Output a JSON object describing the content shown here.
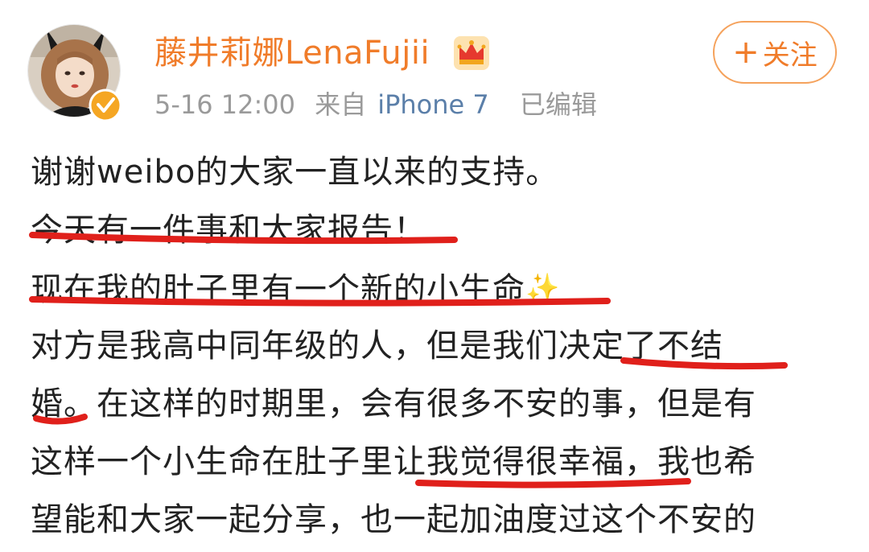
{
  "post": {
    "username": "藤井莉娜LenaFujii",
    "date": "5-16 12:00",
    "source_prefix": "来自",
    "source_device": "iPhone 7",
    "edited": "已编辑",
    "follow_label": "关注",
    "follow_icon": "+",
    "lines": [
      "谢谢weibo的大家一直以来的支持。",
      "今天有一件事和大家报告！",
      "现在我的肚子里有一个新的小生命",
      "对方是我高中同年级的人，但是我们决定了不结",
      "婚。在这样的时期里，会有很多不安的事，但是有",
      "这样一个小生命在肚子里让我觉得很幸福，我也希",
      "望能和大家一起分享，也一起加油度过这个不安的"
    ],
    "sparkle": "✨"
  },
  "icons": {
    "crown": "crown-icon",
    "verified": "verified-badge-icon",
    "avatar": "profile-avatar"
  },
  "colors": {
    "username": "#f07c2a",
    "meta": "#9a9a9a",
    "device": "#5b7fa9",
    "follow_border": "#f5a25c",
    "annotation": "#e0201b",
    "verified": "#f5a623"
  }
}
